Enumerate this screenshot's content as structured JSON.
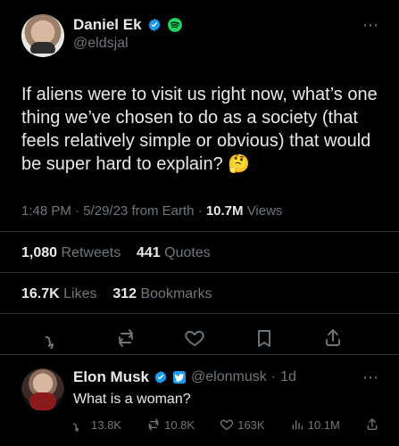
{
  "colors": {
    "background": "#000000",
    "text": "#e7e9ea",
    "muted": "#71767b",
    "verified_blue": "#1d9bf0",
    "spotify_green": "#1ed760",
    "divider": "#2f3336"
  },
  "tweet": {
    "author_name": "Daniel Ek",
    "handle": "@eldsjal",
    "text": "If aliens were to visit us right now, what’s one thing we’ve chosen to do as a society (that feels relatively simple or obvious) that would be super hard to explain? 🤔",
    "time": "1:48 PM",
    "date": "5/29/23",
    "source": "from Earth",
    "views": "10.7M",
    "views_label": "Views",
    "stats": {
      "retweets": "1,080",
      "retweets_label": "Retweets",
      "quotes": "441",
      "quotes_label": "Quotes",
      "likes": "16.7K",
      "likes_label": "Likes",
      "bookmarks": "312",
      "bookmarks_label": "Bookmarks"
    },
    "icons": {
      "reply": "comment-icon",
      "retweet": "retweet-icon",
      "like": "heart-icon",
      "bookmark": "bookmark-icon",
      "share": "share-icon"
    }
  },
  "reply": {
    "author_name": "Elon Musk",
    "handle": "@elonmusk",
    "age": "1d",
    "text": "What is a woman?",
    "metrics": {
      "replies": "13.8K",
      "retweets": "10.8K",
      "likes": "163K",
      "views": "10.1M"
    }
  }
}
